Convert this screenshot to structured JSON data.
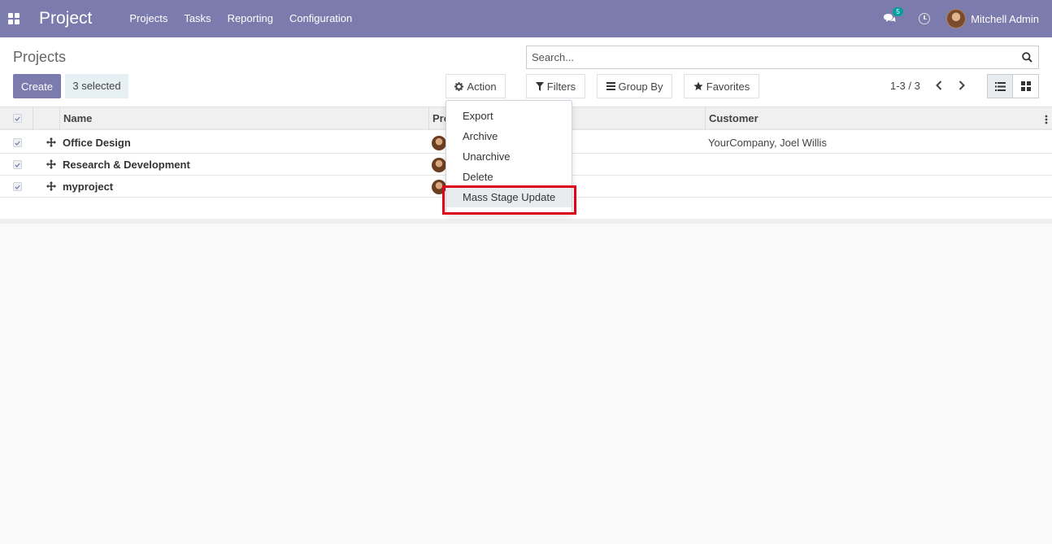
{
  "navbar": {
    "brand": "Project",
    "menu": [
      "Projects",
      "Tasks",
      "Reporting",
      "Configuration"
    ],
    "chat_badge": "5",
    "user": "Mitchell Admin",
    "bg_color": "#7c7bad"
  },
  "control_panel": {
    "breadcrumb": "Projects",
    "create_label": "Create",
    "selected_label": "3 selected",
    "action_label": "Action",
    "search_placeholder": "Search...",
    "filters_label": "Filters",
    "group_by_label": "Group By",
    "favorites_label": "Favorites",
    "pager": "1-3 / 3"
  },
  "table": {
    "columns": [
      "Name",
      "Pro",
      "Customer"
    ],
    "rows": [
      {
        "name": "Office Design",
        "customer": "YourCompany, Joel Willis"
      },
      {
        "name": "Research & Development",
        "customer": ""
      },
      {
        "name": "myproject",
        "customer": ""
      }
    ]
  },
  "action_menu": {
    "items": [
      "Export",
      "Archive",
      "Unarchive",
      "Delete",
      "Mass Stage Update"
    ],
    "highlighted": "Mass Stage Update",
    "highlight_color": "#e0001a"
  }
}
